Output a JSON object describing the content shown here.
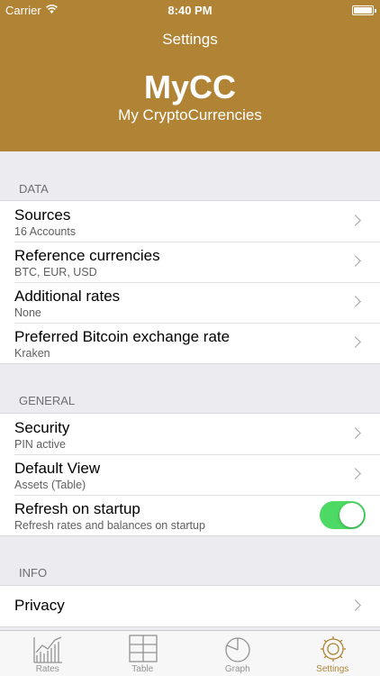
{
  "status": {
    "carrier": "Carrier",
    "wifi_icon": "wifi-icon",
    "time": "8:40 PM",
    "battery_icon": "battery-icon"
  },
  "header": {
    "nav_title": "Settings",
    "app_name": "MyCC",
    "app_subtitle": "My CryptoCurrencies",
    "background_color": "#b08434"
  },
  "sections": {
    "data": {
      "header": "DATA",
      "rows": [
        {
          "title": "Sources",
          "subtitle": "16 Accounts"
        },
        {
          "title": "Reference currencies",
          "subtitle": "BTC, EUR, USD"
        },
        {
          "title": "Additional rates",
          "subtitle": "None"
        },
        {
          "title": "Preferred Bitcoin exchange rate",
          "subtitle": "Kraken"
        }
      ]
    },
    "general": {
      "header": "GENERAL",
      "rows": [
        {
          "title": "Security",
          "subtitle": "PIN active"
        },
        {
          "title": "Default View",
          "subtitle": "Assets (Table)"
        },
        {
          "title": "Refresh on startup",
          "subtitle": "Refresh rates and balances on startup",
          "toggle_on": true
        }
      ]
    },
    "info": {
      "header": "INFO",
      "rows": [
        {
          "title": "Privacy"
        }
      ]
    }
  },
  "tabbar": {
    "tabs": [
      {
        "label": "Rates",
        "icon": "line-chart-icon"
      },
      {
        "label": "Table",
        "icon": "table-grid-icon"
      },
      {
        "label": "Graph",
        "icon": "pie-chart-icon"
      },
      {
        "label": "Settings",
        "icon": "gear-icon",
        "active": true
      }
    ]
  },
  "colors": {
    "accent": "#b08434",
    "toggle_on": "#4cd964",
    "background": "#ececf0"
  }
}
